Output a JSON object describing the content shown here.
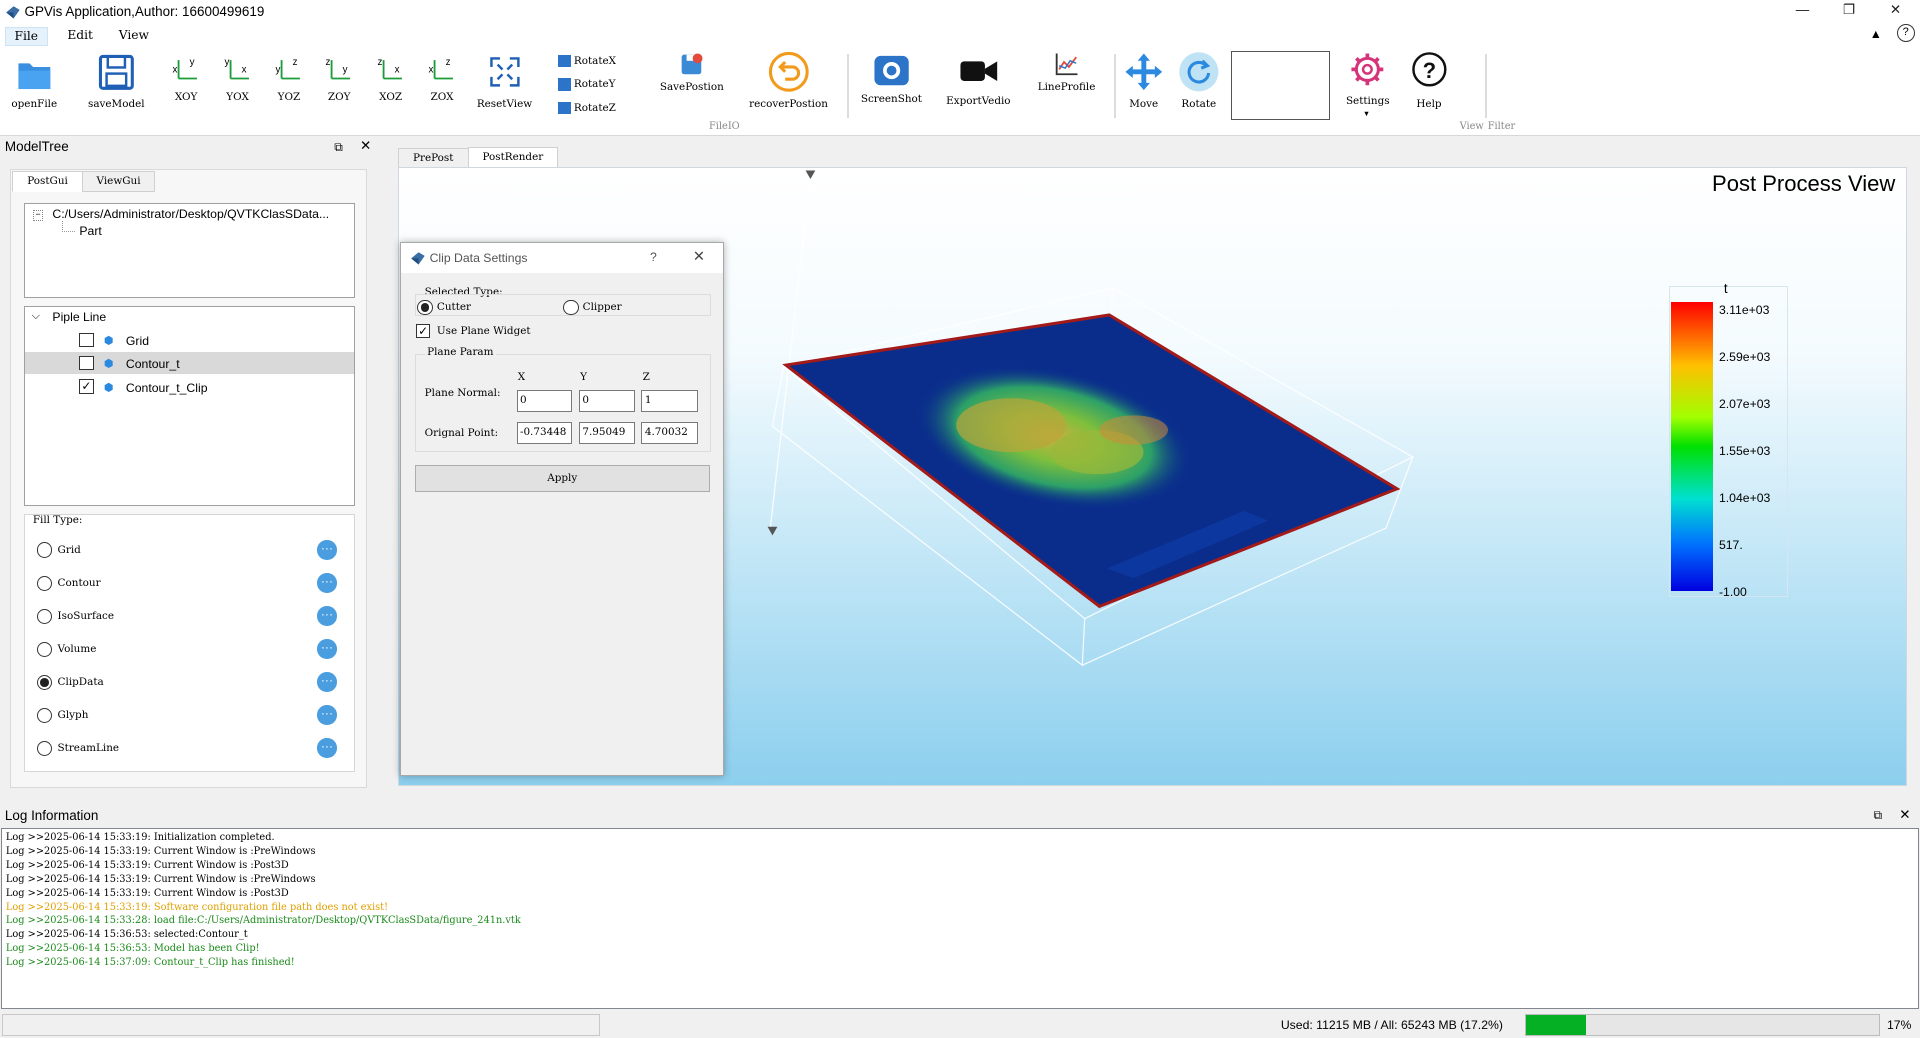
{
  "window": {
    "title": "GPVis Application,Author: 16600499619"
  },
  "menu": [
    "File",
    "Edit",
    "View"
  ],
  "toolbar": {
    "open_file": "openFile",
    "save_model": "saveModel",
    "xoy": "XOY",
    "yox": "YOX",
    "yoz": "YOZ",
    "zoy": "ZOY",
    "xoz": "XOZ",
    "zox": "ZOX",
    "reset_view": "ResetView",
    "rotate_x": "RotateX",
    "rotate_y": "RotateY",
    "rotate_z": "RotateZ",
    "save_position": "SavePostion",
    "recover_position": "recoverPostion",
    "screenshot": "ScreenShot",
    "export_video": "ExportVedio",
    "line_profile": "LineProfile",
    "move": "Move",
    "rotate": "Rotate",
    "settings": "Settings",
    "help": "Help",
    "group_fileio": "FileIO",
    "group_view": "View",
    "group_filter": "Filter"
  },
  "model_tree": {
    "title": "ModelTree",
    "tabs": [
      "PostGui",
      "ViewGui"
    ],
    "file_path": "C:/Users/Administrator/Desktop/QVTKClasSData...",
    "child": "Part",
    "pipeline_title": "Piple Line",
    "pipeline_items": [
      {
        "label": "Grid",
        "checked": false
      },
      {
        "label": "Contour_t",
        "checked": false
      },
      {
        "label": "Contour_t_Clip",
        "checked": true
      }
    ],
    "fill_type_title": "Fill Type:",
    "fill_types": [
      "Grid",
      "Contour",
      "IsoSurface",
      "Volume",
      "ClipData",
      "Glyph",
      "StreamLine"
    ],
    "fill_selected": "ClipData"
  },
  "view_tabs": [
    "PrePost",
    "PostRender"
  ],
  "view": {
    "title": "Post Process View",
    "scalar_name": "t",
    "legend_labels": [
      "3.11e+03",
      "2.59e+03",
      "2.07e+03",
      "1.55e+03",
      "1.04e+03",
      "517.",
      "-1.00"
    ]
  },
  "dialog": {
    "title": "Clip Data Settings",
    "help": "?",
    "selected_type_label": "Selected Type:",
    "cutter": "Cutter",
    "clipper": "Clipper",
    "selected": "Cutter",
    "use_plane_widget": "Use Plane Widget",
    "use_plane_checked": true,
    "plane_param": "Plane Param",
    "col_x": "X",
    "col_y": "Y",
    "col_z": "Z",
    "plane_normal_label": "Plane Normal:",
    "normal": [
      "0",
      "0",
      "1"
    ],
    "origin_label": "Orignal Point:",
    "origin": [
      "-0.73448",
      "7.95049",
      "4.70032"
    ],
    "apply": "Apply"
  },
  "log": {
    "title": "Log Information",
    "lines": [
      {
        "text": "Log >>2025-06-14 15:33:19: Initialization completed.",
        "color": "#000000"
      },
      {
        "text": "Log >>2025-06-14 15:33:19: Current Window is :PreWindows",
        "color": "#000000"
      },
      {
        "text": "Log >>2025-06-14 15:33:19: Current Window is :Post3D",
        "color": "#000000"
      },
      {
        "text": "Log >>2025-06-14 15:33:19: Current Window is :PreWindows",
        "color": "#000000"
      },
      {
        "text": "Log >>2025-06-14 15:33:19: Current Window is :Post3D",
        "color": "#000000"
      },
      {
        "text": "Log >>2025-06-14 15:33:19: Software configuration file path does not exist!",
        "color": "#e0a000"
      },
      {
        "text": "Log >>2025-06-14 15:33:28: load file:C:/Users/Administrator/Desktop/QVTKClasSData/figure_241n.vtk",
        "color": "#1a8a1a"
      },
      {
        "text": "Log >>2025-06-14 15:36:53: selected:Contour_t",
        "color": "#000000"
      },
      {
        "text": "Log >>2025-06-14 15:36:53: Model has been Clip!",
        "color": "#1a8a1a"
      },
      {
        "text": "Log >>2025-06-14 15:37:09: Contour_t_Clip has finished!",
        "color": "#1a8a1a"
      }
    ]
  },
  "status": {
    "memory": "Used: 11215 MB / All: 65243 MB (17.2%)",
    "progress_fraction": 0.17,
    "progress_text": "17%"
  },
  "colors": {
    "accent": "#0078d7",
    "progress": "#06b025",
    "viewport_top": "#ffffff",
    "viewport_bottom": "#8ccfee"
  }
}
